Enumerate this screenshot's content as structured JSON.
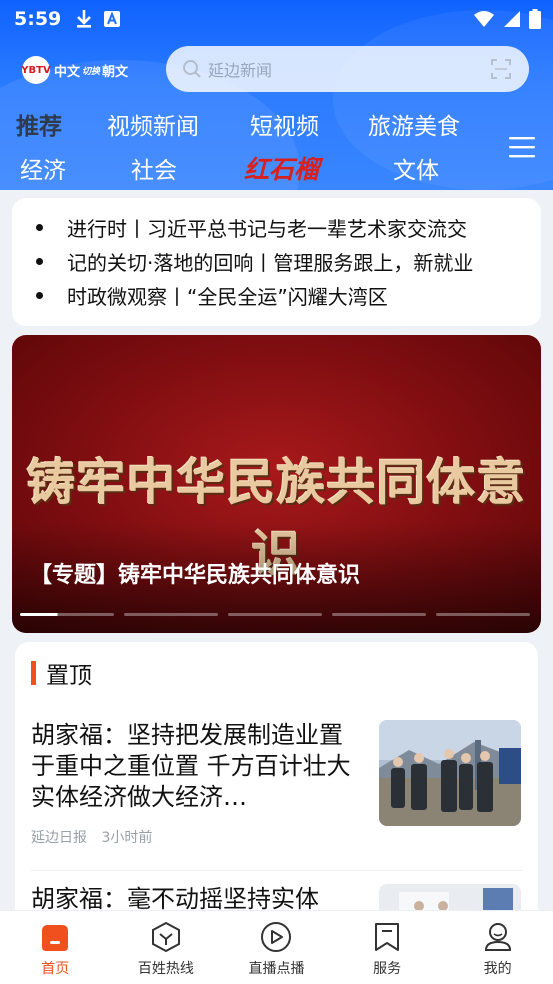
{
  "status": {
    "time": "5:59"
  },
  "header": {
    "logo_text_cn": "中文",
    "logo_switch": "切换",
    "logo_text_kr": "朝文",
    "logo_badge": "YBTV",
    "search_placeholder": "延边新闻"
  },
  "tabs": {
    "row1": [
      "推荐",
      "视频新闻",
      "短视频",
      "旅游美食"
    ],
    "row2": [
      "经济",
      "社会",
      "红石榴",
      "文体"
    ]
  },
  "ticker": {
    "items": [
      "进行时丨习近平总书记与老一辈艺术家交流交",
      "记的关切·落地的回响丨管理服务跟上，新就业",
      "时政微观察丨“全民全运”闪耀大湾区"
    ]
  },
  "banner": {
    "headline": "铸牢中华民族共同体意识",
    "caption": "【专题】铸牢中华民族共同体意识",
    "slide_count": 5,
    "active_slide": 1
  },
  "pinned": {
    "label": "置顶",
    "news": [
      {
        "title": "胡家福：坚持把发展制造业置于重中之重位置 千方百计壮大实体经济做大经济…",
        "source": "延边日报",
        "time": "3小时前"
      },
      {
        "title": "胡家福：毫不动摇坚持实体"
      }
    ]
  },
  "nav": {
    "items": [
      "首页",
      "百姓热线",
      "直播点播",
      "服务",
      "我的"
    ],
    "active": 0
  },
  "colors": {
    "header_blue": "#1f6fff",
    "accent_orange": "#f0501e",
    "brand_red": "#d8211c"
  }
}
